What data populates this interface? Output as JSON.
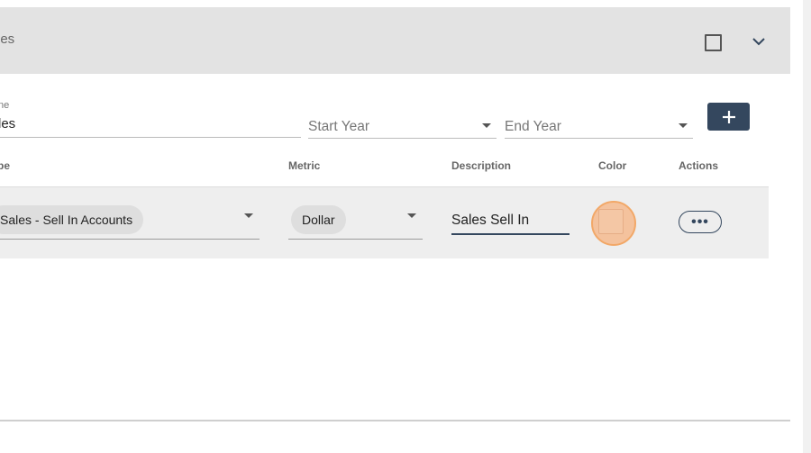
{
  "header": {
    "title": "les"
  },
  "form": {
    "name_label": "ne",
    "name_value": "les",
    "start_year_placeholder": "Start Year",
    "end_year_placeholder": "End Year",
    "add_label": "+"
  },
  "table": {
    "columns": [
      "pe",
      "Metric",
      "Description",
      "Color",
      "Actions"
    ],
    "rows": [
      {
        "type": "Sales - Sell In Accounts",
        "metric": "Dollar",
        "description": "Sales Sell In",
        "actions_label": "•••"
      }
    ]
  },
  "colors": {
    "header_bg": "#e3e3e3",
    "primary": "#34475e",
    "row_bg": "#eeeeee",
    "highlight": "#f4c29d"
  }
}
